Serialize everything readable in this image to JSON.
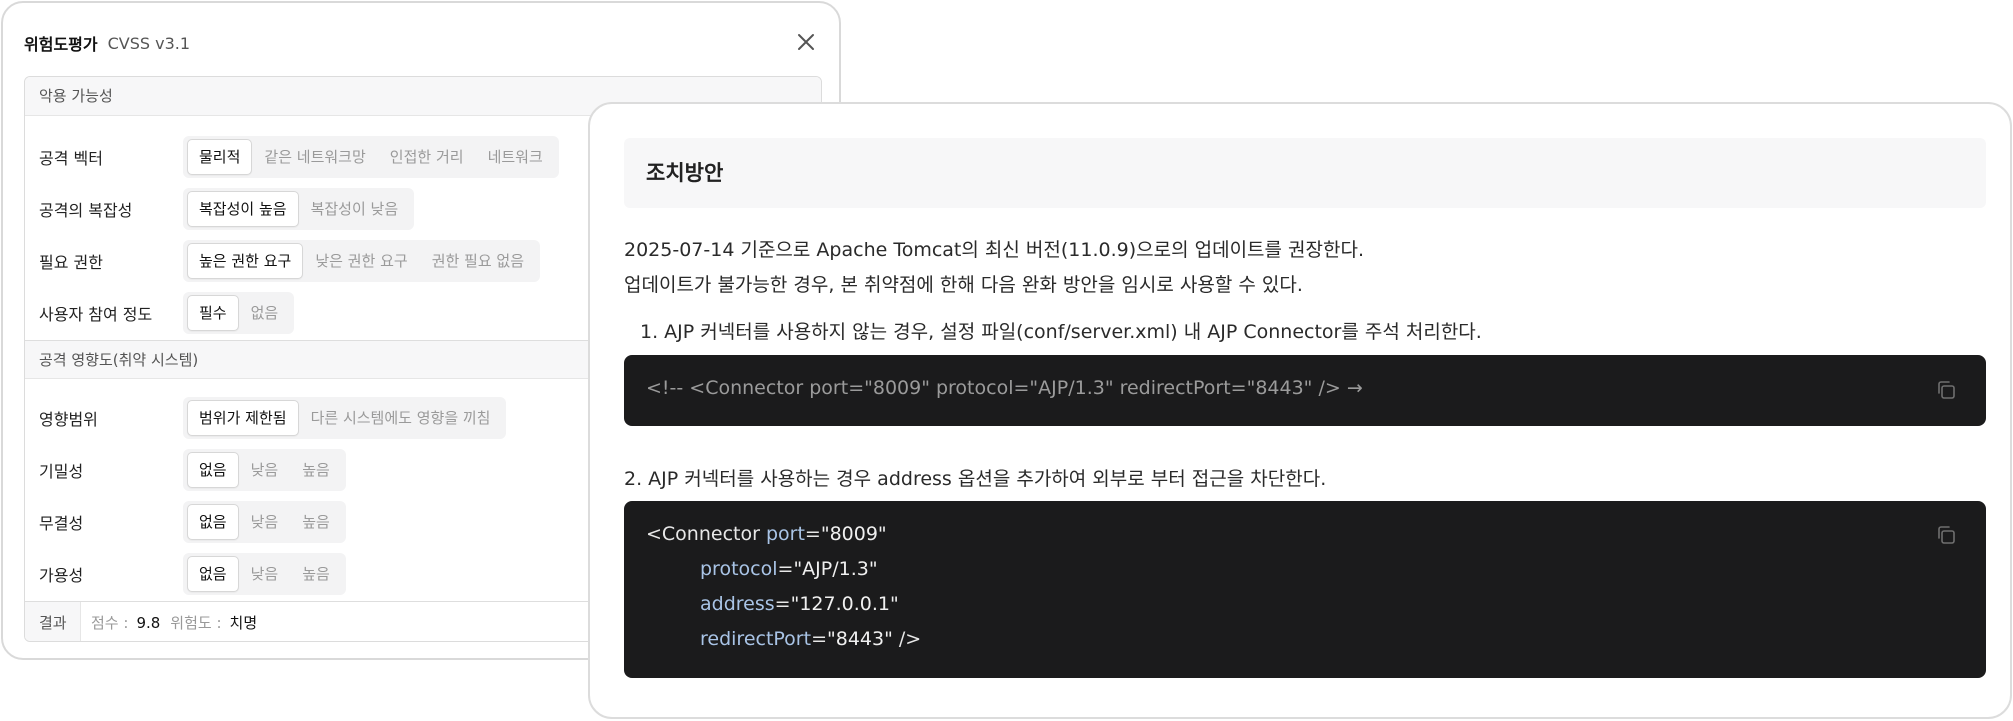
{
  "cvss_panel": {
    "title": "위험도평가",
    "subtitle": "CVSS v3.1",
    "sections": [
      {
        "heading": "악용 가능성"
      },
      {
        "heading": "공격 영향도(취약 시스템)"
      }
    ],
    "metrics": [
      {
        "label": "공격 벡터",
        "options": [
          "물리적",
          "같은 네트워크망",
          "인접한 거리",
          "네트워크"
        ],
        "selected": "물리적"
      },
      {
        "label": "공격의 복잡성",
        "options": [
          "복잡성이 높음",
          "복잡성이 낮음"
        ],
        "selected": "복잡성이 높음"
      },
      {
        "label": "필요 권한",
        "options": [
          "높은 권한 요구",
          "낮은 권한 요구",
          "권한 필요 없음"
        ],
        "selected": "높은 권한 요구"
      },
      {
        "label": "사용자 참여 정도",
        "options": [
          "필수",
          "없음"
        ],
        "selected": "필수"
      },
      {
        "label": "영향범위",
        "options": [
          "범위가 제한됨",
          "다른 시스템에도 영향을 끼침"
        ],
        "selected": "범위가 제한됨"
      },
      {
        "label": "기밀성",
        "options": [
          "없음",
          "낮음",
          "높음"
        ],
        "selected": "없음"
      },
      {
        "label": "무결성",
        "options": [
          "없음",
          "낮음",
          "높음"
        ],
        "selected": "없음"
      },
      {
        "label": "가용성",
        "options": [
          "없음",
          "낮음",
          "높음"
        ],
        "selected": "없음"
      }
    ],
    "result": {
      "label": "결과",
      "score_key": "점수 :",
      "score_value": "9.8",
      "severity_key": "위험도 :",
      "severity_value": "치명"
    }
  },
  "remediation_panel": {
    "title": "조치방안",
    "intro_line1": "2025-07-14 기준으로 Apache Tomcat의 최신 버전(11.0.9)으로의 업데이트를 권장한다.",
    "intro_line2": "업데이트가 불가능한 경우, 본 취약점에 한해 다음 완화 방안을 임시로 사용할 수 있다.",
    "step1": "1.  AJP 커넥터를 사용하지 않는 경우, 설정 파일(conf/server.xml) 내 AJP Connector를 주석 처리한다.",
    "code1": "<!-- <Connector port=\"8009\" protocol=\"AJP/1.3\" redirectPort=\"8443\" /> →",
    "step2": "2. AJP 커넥터를 사용하는 경우 address 옵션을 추가하여 외부로 부터 접근을 차단한다.",
    "code2": {
      "tag_open": "<Connector ",
      "attrs": [
        {
          "name": "port",
          "value": "\"8009\""
        },
        {
          "name": "protocol",
          "value": "\"AJP/1.3\""
        },
        {
          "name": "address",
          "value": "\"127.0.0.1\""
        },
        {
          "name": "redirectPort",
          "value": "\"8443\""
        }
      ],
      "eq": "=",
      "tag_close": " />"
    }
  },
  "colors": {
    "code_background": "#1b1b1c",
    "code_attr": "#a9c4e6",
    "panel_border": "#dcdcdc"
  },
  "icons": {
    "close": "close-icon",
    "copy": "copy-icon"
  }
}
